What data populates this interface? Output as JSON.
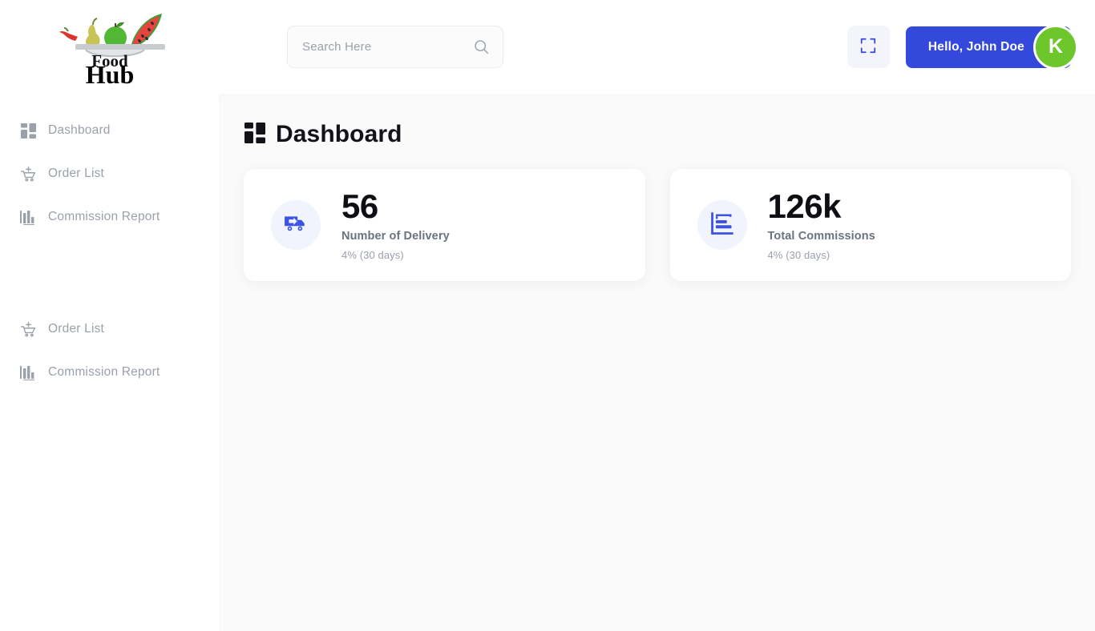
{
  "brand": {
    "logo_line1": "Food",
    "logo_line2": "Hub",
    "logo_icon": "plate-with-fruits-logo"
  },
  "sidebar": {
    "groups": [
      {
        "items": [
          {
            "label": "Dashboard",
            "icon": "grid-icon"
          },
          {
            "label": "Order List",
            "icon": "cart-plus-icon"
          },
          {
            "label": "Commission Report",
            "icon": "bar-chart-icon"
          }
        ]
      },
      {
        "items": [
          {
            "label": "Order List",
            "icon": "cart-plus-icon"
          },
          {
            "label": "Commission Report",
            "icon": "bar-chart-icon"
          }
        ]
      }
    ]
  },
  "header": {
    "search": {
      "placeholder": "Search Here",
      "value": "",
      "icon": "search-icon"
    },
    "fullscreen_icon": "fullscreen-expand-icon",
    "user": {
      "greeting": "Hello, John Doe",
      "avatar_initial": "K",
      "avatar_color": "#6CC62C",
      "pill_color": "#3449DB"
    }
  },
  "main": {
    "title": "Dashboard",
    "title_icon": "grid-icon",
    "cards": [
      {
        "value": "56",
        "label": "Number of Delivery",
        "sub": "4% (30 days)",
        "icon": "delivery-truck-icon",
        "icon_color": "#3B52E4"
      },
      {
        "value": "126k",
        "label": "Total Commissions",
        "sub": "4% (30 days)",
        "icon": "commission-chart-icon",
        "icon_color": "#3B52E4"
      }
    ]
  }
}
